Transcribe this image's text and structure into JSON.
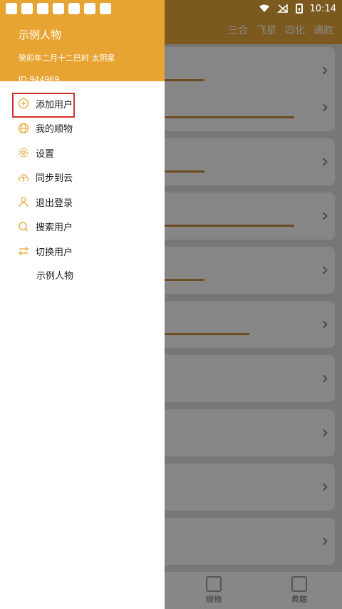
{
  "status": {
    "time": "10:14"
  },
  "background": {
    "tabs": [
      "三合",
      "飞星",
      "四化",
      "通胜"
    ],
    "bottom_nav": [
      {
        "label": "顺物"
      },
      {
        "label": "典籍"
      }
    ]
  },
  "drawer": {
    "user": {
      "name": "示例人物",
      "birth": "癸卯年二月十二巳时 太阴星",
      "id": "ID:944969"
    },
    "menu": [
      {
        "label": "添加用户",
        "icon": "plus-circle-icon"
      },
      {
        "label": "我的顺物",
        "icon": "globe-icon"
      },
      {
        "label": "设置",
        "icon": "gear-icon"
      },
      {
        "label": "同步到云",
        "icon": "cloud-upload-icon"
      },
      {
        "label": "退出登录",
        "icon": "user-icon"
      },
      {
        "label": "搜索用户",
        "icon": "search-icon"
      },
      {
        "label": "切换用户",
        "icon": "swap-icon"
      }
    ],
    "sub_user": "示例人物"
  },
  "colors": {
    "accent": "#e8a433",
    "highlight": "#d32f2f"
  }
}
